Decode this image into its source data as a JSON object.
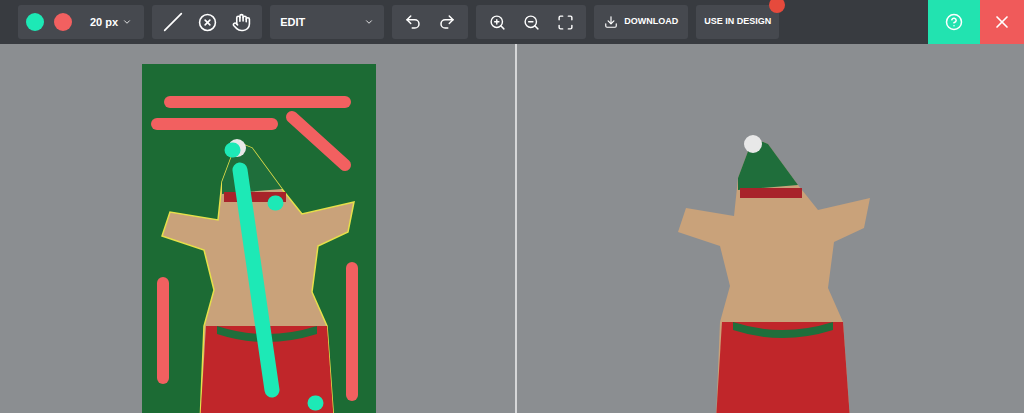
{
  "toolbar": {
    "colors": [
      {
        "name": "keep",
        "color": "#1de9b6"
      },
      {
        "name": "remove",
        "color": "#f26060"
      }
    ],
    "brush_size": "20 px",
    "mode": "EDIT",
    "download": "DOWNLOAD",
    "use_in_design": "USE IN DESIGN"
  },
  "strokes": [
    {
      "kind": "remove",
      "color": "#f26060"
    },
    {
      "kind": "remove",
      "color": "#f26060"
    },
    {
      "kind": "remove",
      "color": "#f26060"
    },
    {
      "kind": "remove",
      "color": "#f26060"
    },
    {
      "kind": "remove",
      "color": "#f26060"
    },
    {
      "kind": "keep",
      "color": "#1de9b6"
    },
    {
      "kind": "keep",
      "color": "#1de9b6"
    },
    {
      "kind": "keep",
      "color": "#1de9b6"
    },
    {
      "kind": "keep",
      "color": "#1de9b6"
    }
  ]
}
